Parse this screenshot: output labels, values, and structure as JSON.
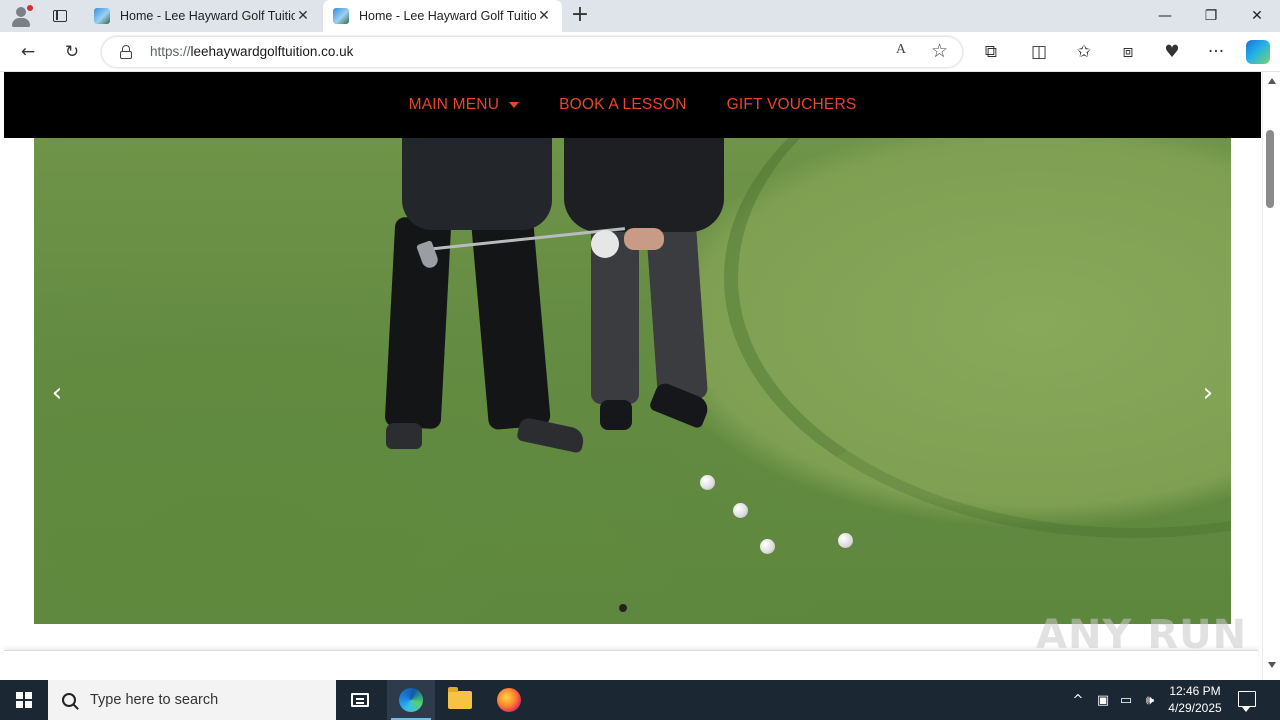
{
  "browser": {
    "tabs": [
      {
        "title": "Home - Lee Hayward Golf Tuition",
        "close_label": "✕",
        "active": false
      },
      {
        "title": "Home - Lee Hayward Golf Tuition",
        "close_label": "✕",
        "active": true
      }
    ],
    "new_tab_label": "+",
    "window_controls": {
      "minimize": "—",
      "restore": "❐",
      "close": "✕"
    },
    "address": {
      "scheme": "https://",
      "host": "leehaywardgolftuition.co.uk"
    },
    "read_aloud_label": "A",
    "favorite_label": "☆",
    "toolbar_icons": {
      "back": "←",
      "refresh": "↻",
      "extensions": "⧉",
      "split": "◫",
      "favorites": "✩",
      "collections": "⧈",
      "performance": "♥",
      "more": "···"
    }
  },
  "site": {
    "nav": {
      "items": [
        {
          "label": "MAIN MENU",
          "has_dropdown": true
        },
        {
          "label": "BOOK A LESSON",
          "has_dropdown": false
        },
        {
          "label": "GIFT VOUCHERS",
          "has_dropdown": false
        }
      ],
      "accent_color": "#e8462a",
      "background": "#000000"
    },
    "slider": {
      "prev_label": "‹",
      "next_label": "›",
      "image_subject": "golf-lesson-on-putting-green",
      "slide_count_visible": 1
    },
    "watermark": "ANY RUN"
  },
  "taskbar": {
    "search_placeholder": "Type here to search",
    "apps": [
      "task-view",
      "microsoft-edge",
      "file-explorer",
      "firefox"
    ],
    "tray": {
      "chevron": "^",
      "time": "12:46 PM",
      "date": "4/29/2025"
    }
  }
}
